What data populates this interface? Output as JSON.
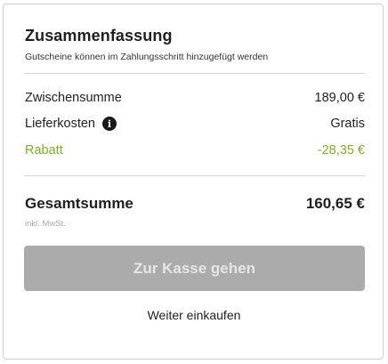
{
  "summary": {
    "title": "Zusammenfassung",
    "subtitle": "Gutscheine können im Zahlungsschritt hinzugefügt werden",
    "rows": [
      {
        "label": "Zwischensumme",
        "value": "189,00 €"
      },
      {
        "label": "Lieferkosten",
        "value": "Gratis",
        "icon": "info-icon"
      },
      {
        "label": "Rabatt",
        "value": "-28,35 €",
        "color": "#7bb21f"
      }
    ],
    "total": {
      "label": "Gesamtsumme",
      "value": "160,65 €",
      "tax_note": "inkl. MwSt."
    },
    "checkout_label": "Zur Kasse gehen",
    "continue_label": "Weiter einkaufen"
  },
  "colors": {
    "discount": "#7bb21f",
    "button_bg": "#ababab",
    "button_text": "#e6e6e6",
    "divider": "#d6d6d6"
  }
}
